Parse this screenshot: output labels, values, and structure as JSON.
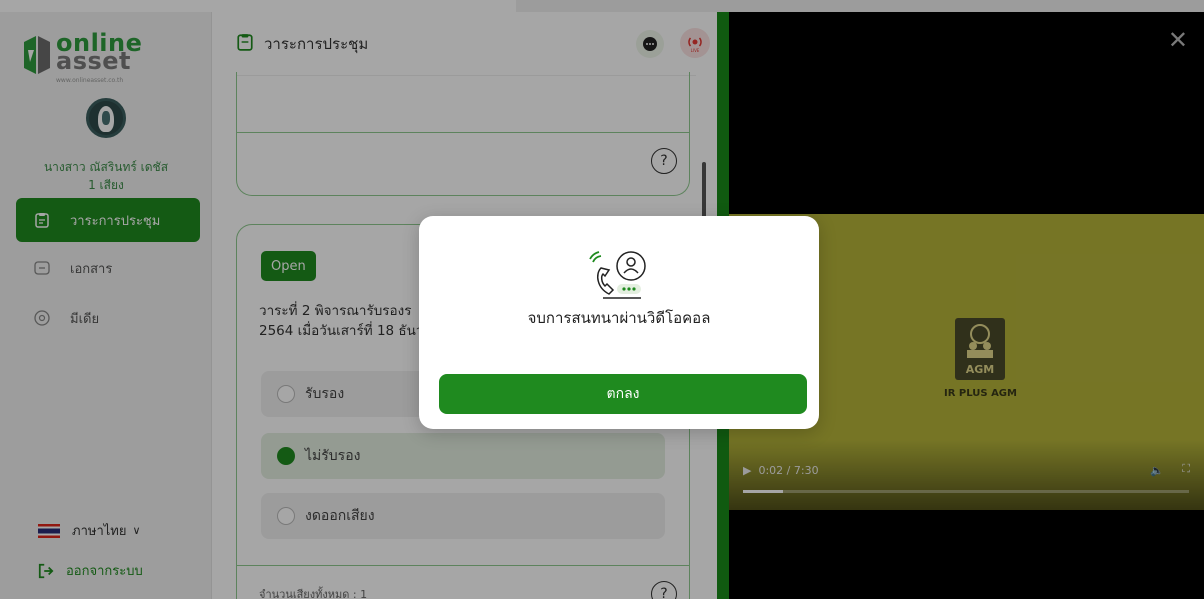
{
  "brand": {
    "line1": "online",
    "line2": "asset",
    "line3": "www.onlineasset.co.th"
  },
  "user": {
    "name": "นางสาว ณัสรินทร์ เดชัส",
    "votes": "1 เสียง"
  },
  "sidebar": {
    "items": [
      {
        "label": "วาระการประชุม",
        "icon": "clipboard-icon",
        "active": true
      },
      {
        "label": "เอกสาร",
        "icon": "folder-icon",
        "active": false
      },
      {
        "label": "มีเดีย",
        "icon": "play-circle-icon",
        "active": false
      }
    ],
    "language": "ภาษาไทย",
    "logout": "ออกจากระบบ"
  },
  "main": {
    "title": "วาระการประชุม",
    "card": {
      "status": "Open",
      "agenda": "วาระที่ 2 พิจารณารับรองร\n2564 เมื่อวันเสาร์ที่ 18 ธันว",
      "options": [
        {
          "label": "รับรอง",
          "selected": false
        },
        {
          "label": "ไม่รับรอง",
          "selected": true
        },
        {
          "label": "งดออกเสียง",
          "selected": false
        }
      ],
      "footer": "จำนวนเสียงทั้งหมด : 1"
    }
  },
  "video": {
    "caption": "IR PLUS AGM",
    "logo_text": "AGM",
    "time": "0:02 / 7:30",
    "progress": 0.09
  },
  "modal": {
    "message": "จบการสนทนาผ่านวิดีโอคอล",
    "ok_label": "ตกลง"
  },
  "colors": {
    "primary": "#1f8a1f",
    "live": "#e53935",
    "video_bg": "#b5b43a"
  }
}
